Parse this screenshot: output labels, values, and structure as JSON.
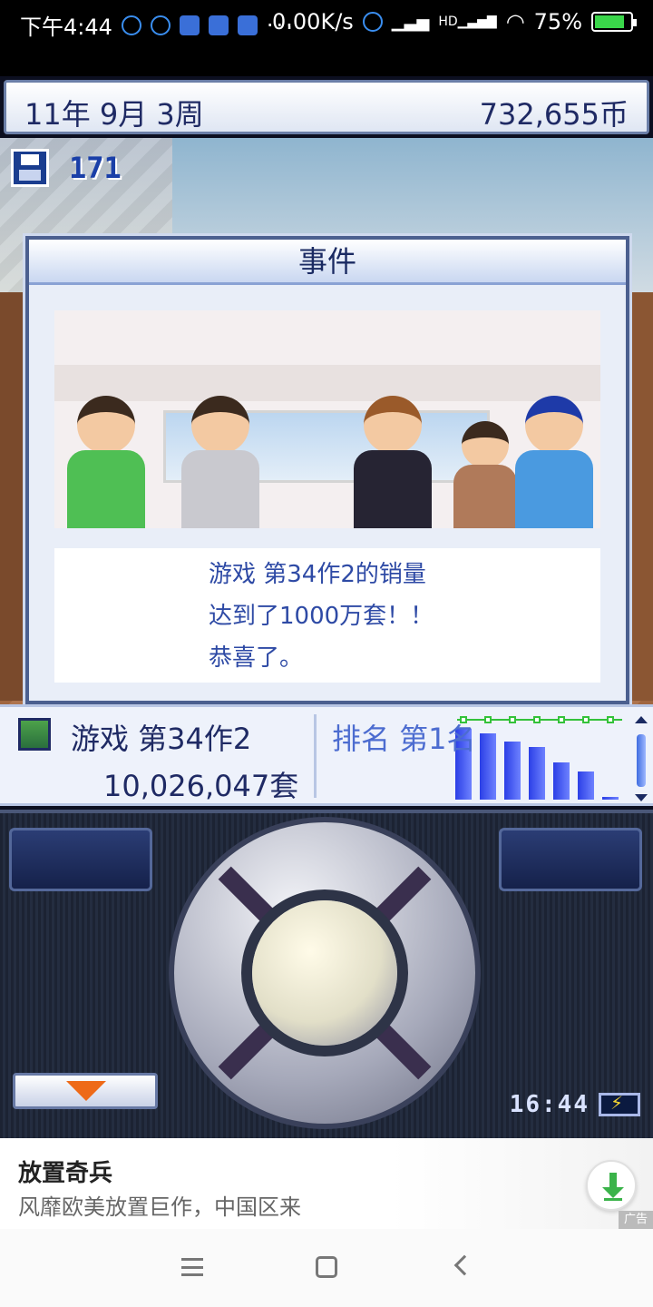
{
  "status_bar": {
    "time": "下午4:44",
    "more": "···",
    "net_speed": "0.00K/s",
    "hd_label": "HD",
    "battery": "75%"
  },
  "header": {
    "date": "11年 9月 3周",
    "money": "732,655币"
  },
  "save": {
    "count": "171"
  },
  "event_dialog": {
    "title": "事件",
    "lines": [
      "游戏 第34作2的销量",
      "达到了1000万套！！",
      "恭喜了。"
    ]
  },
  "ranking": {
    "game_name": "游戏 第34作2",
    "sales": "10,026,047套",
    "rank_label": "排名 第1名"
  },
  "chart_data": {
    "type": "bar",
    "values": [
      100,
      94,
      82,
      74,
      52,
      40,
      4
    ],
    "ylim": [
      0,
      100
    ]
  },
  "controller": {
    "clock": "16:44"
  },
  "ad": {
    "title": "放置奇兵",
    "subtitle": "风靡欧美放置巨作，中国区来",
    "tag": "广告"
  },
  "colors": {
    "accent": "#4c6cd0",
    "dialog_text": "#2e4aa5",
    "menu_arrow": "#ee6a18",
    "ad_download": "#3bb34a"
  }
}
